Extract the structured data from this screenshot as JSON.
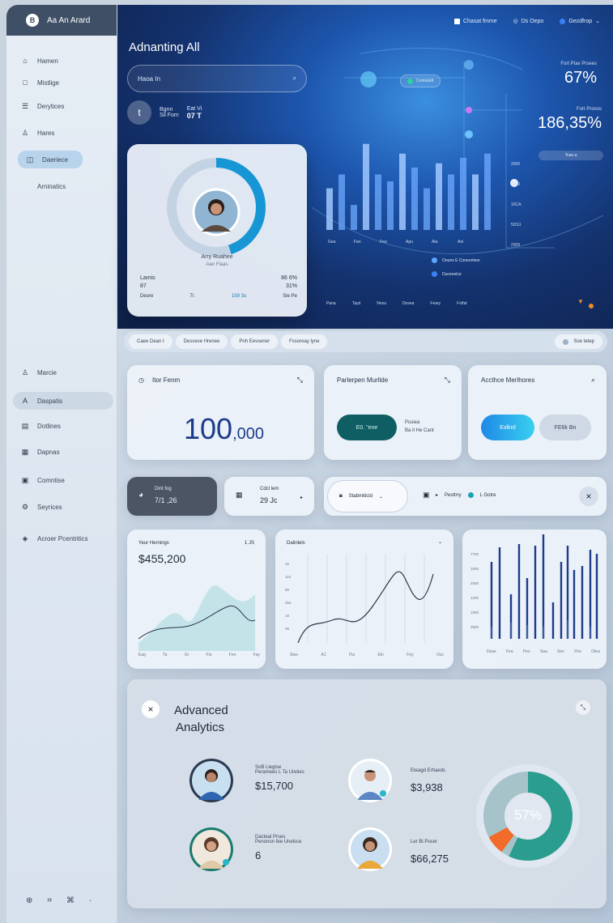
{
  "app": {
    "title": "Aa An Arard",
    "logo_glyph": "B"
  },
  "sidebar": {
    "items": [
      {
        "label": "Hamen",
        "icon": "home-icon",
        "glyph": "⌂"
      },
      {
        "label": "Mistlige",
        "icon": "doc-icon",
        "glyph": "□"
      },
      {
        "label": "Derytices",
        "icon": "list-icon",
        "glyph": "☰"
      },
      {
        "label": "Hares",
        "icon": "user-icon",
        "glyph": "♙"
      },
      {
        "label": "Daeriece",
        "icon": "box-icon",
        "glyph": "◫"
      },
      {
        "label": "Arninatics",
        "icon": "",
        "glyph": ""
      }
    ],
    "items2": [
      {
        "label": "Marcie",
        "icon": "person-icon",
        "glyph": "♙"
      },
      {
        "label": "Daspatis",
        "icon": "letter-a-icon",
        "glyph": "A"
      },
      {
        "label": "Dotlines",
        "icon": "image-icon",
        "glyph": "▤"
      },
      {
        "label": "Dapnas",
        "icon": "grid-icon",
        "glyph": "▦"
      },
      {
        "label": "Comntise",
        "icon": "calendar-icon",
        "glyph": "▣"
      },
      {
        "label": "Seyrices",
        "icon": "settings-icon",
        "glyph": "⚙"
      },
      {
        "label": "Acroer Pcentritics",
        "icon": "tag-icon",
        "glyph": "◈"
      }
    ],
    "footer": [
      "⊕",
      "⌗",
      "⌘",
      "·"
    ]
  },
  "header": {
    "title": "Adnanting All",
    "nav": [
      {
        "label": "Chasat fmme",
        "color": "#ffffff"
      },
      {
        "label": "Ds Oepo",
        "color": "#cfe1ff"
      },
      {
        "label": "Gezdfrop",
        "color": "#3b82f6"
      }
    ],
    "chevron": "⌄"
  },
  "search": {
    "placeholder": "Haoa In",
    "icon_glyph": "⌕"
  },
  "mini_stats": {
    "initial": "t",
    "k1": "Bgnn",
    "v1": "Sil Fom",
    "k2": "Eat Vi",
    "v2": "07 T"
  },
  "profile": {
    "name": "Arry Ruahee",
    "sub": "Aan Flaas",
    "rows": [
      {
        "k": "Lamis",
        "v": "86 6%"
      },
      {
        "k": "87",
        "v": "31%"
      },
      {
        "k": "Deore",
        "m1": "7/.",
        "m2": "159 3u",
        "v": "Sie Pe"
      }
    ],
    "ring_fraction": 0.45
  },
  "hero_stats": [
    {
      "label": "Fort Ptav Prsees",
      "value": "67%"
    },
    {
      "label": "Fort Prosos",
      "value": "186,35%"
    }
  ],
  "hero_pill": "Tcan.a",
  "hero_chip": "Contadelt",
  "hero_chart": {
    "values": [
      30,
      40,
      18,
      62,
      40,
      35,
      55,
      45,
      30,
      48,
      40,
      52,
      40,
      55
    ],
    "xticks": [
      "Gea",
      "Fan",
      "Fea",
      "Apu",
      "Ata",
      "Ani"
    ],
    "yticks": [
      "2006",
      "2500",
      "16CA",
      "5DS1",
      "2309",
      "1SOfE"
    ],
    "legend": [
      "Oouns E Coneonhee",
      "Duceeelce"
    ],
    "bottom_labels": [
      "Pana",
      "Tayd",
      "Nesa",
      "Dosea",
      "Feary",
      "Folfat"
    ]
  },
  "filterbar": {
    "chips": [
      "Caee Dean t",
      "Desseve Hrenee",
      "Pnh Eevsener",
      "Fssoreay lyne"
    ],
    "right": "Soe tetep"
  },
  "cards": {
    "main_metric": {
      "title": "Itor Fenm",
      "value": "100",
      "suffix": ",000"
    },
    "card2": {
      "title": "Parlerpen Murllde",
      "btn": "E0. \"ene",
      "sub1": "Pusiea",
      "sub2": "Ba Il He Cant"
    },
    "card3": {
      "title": "Accthce Merlhores",
      "btn1": "Exlkrd",
      "btn2": "FE6k Bn"
    }
  },
  "row3": {
    "a_label": "Dint fog",
    "a_value": "7/1 ,26",
    "b_label": "Cdcl lem",
    "b_value": "29 Jc",
    "c_label": "Stabmiticld",
    "d_items": [
      "Pesttrry",
      "L Gotre"
    ]
  },
  "charts": {
    "earnings": {
      "title": "Yeur Hernings",
      "value": "$455,200",
      "corner": "1 JS",
      "xticks": [
        "Eag",
        "Ta",
        "Gr",
        "Fin",
        "Fen",
        "Fay"
      ]
    },
    "dataline": {
      "title": "Dalinlels",
      "xticks": [
        "Siee",
        "A1",
        "Fla",
        "Eln",
        "Fey",
        "Osc"
      ],
      "yticks": [
        "rts",
        "110",
        "80",
        "2ba",
        "18",
        "35"
      ]
    },
    "bars": {
      "xticks": [
        "Deas",
        "Fea",
        "Pes",
        "Saa",
        "Sen",
        "Fhe",
        "Otea"
      ],
      "yticks": [
        "7700",
        "1500",
        "2500",
        "1200",
        "1800",
        "2500"
      ]
    }
  },
  "analytics": {
    "title_l1": "Advanced",
    "title_l2": "Analytics",
    "people": [
      {
        "l1": "SoB Llegtse",
        "l2": "Peramees L Ta Ureties",
        "value": "$15,700"
      },
      {
        "l1": "Eteagd Erhaeds",
        "l2": "",
        "value": "$3,938"
      },
      {
        "l1": "Dacteal Prses",
        "l2": "Penonon fee Unelsce",
        "value": "6"
      },
      {
        "l1": "Ler Bi Pocer",
        "l2": "",
        "value": "$66,275"
      }
    ],
    "donut_label": "57%",
    "donut_fraction": 0.57
  },
  "colors": {
    "accent": "#1e88e5",
    "teal": "#2a9d8f",
    "orange": "#f26b2a",
    "dark_teal": "#0f5e63"
  }
}
